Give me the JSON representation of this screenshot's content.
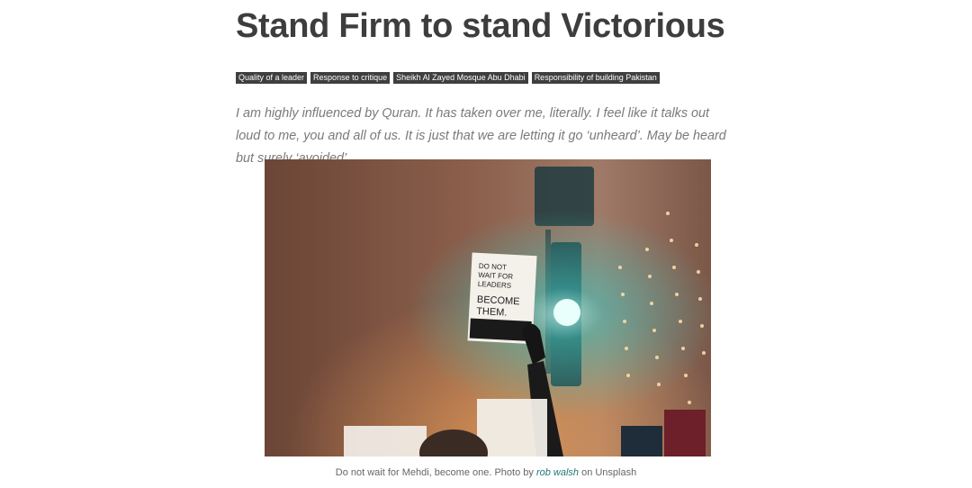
{
  "article": {
    "title": "Stand Firm to stand Victorious",
    "tags": [
      "Quality of a leader",
      "Response to critique",
      "Sheikh Al Zayed Mosque Abu Dhabi",
      "Responsibility of building Pakistan"
    ],
    "lead": "I am highly influenced by Quran. It has taken over me, literally. I feel like it talks out loud to me, you and all of us. It is just that we are letting it go ‘unheard’. May be heard but surely ‘avoided’.",
    "image": {
      "sign_text_line1": "DO NOT",
      "sign_text_line2": "WAIT FOR",
      "sign_text_line3": "LEADERS",
      "sign_text_line4": "BECOME",
      "sign_text_line5": "THEM."
    },
    "caption": {
      "before": "Do not wait for Mehdi, become one. Photo by ",
      "author": "rob walsh",
      "after": " on Unsplash"
    }
  },
  "colors": {
    "title": "#3d3d3d",
    "tag_bg": "#3f3f3f",
    "lead": "#7a7a7a",
    "link": "#1f7a74"
  }
}
